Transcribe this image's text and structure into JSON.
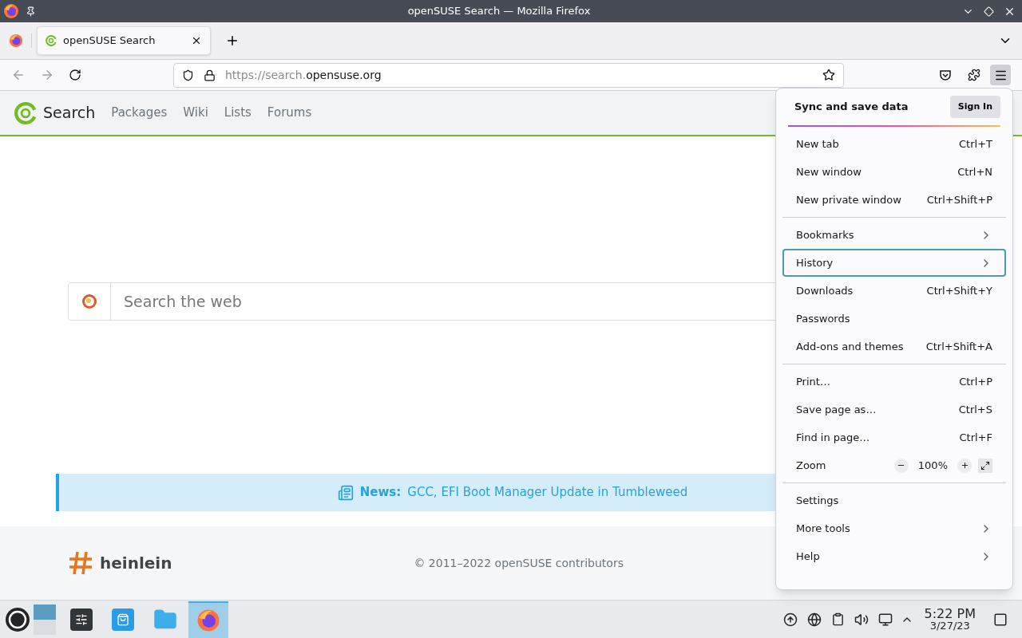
{
  "window": {
    "title": "openSUSE Search — Mozilla Firefox"
  },
  "tabs": [
    {
      "label": "openSUSE Search",
      "selected": true
    }
  ],
  "address_bar": {
    "url_prefix": "https://search.",
    "url_domain": "opensuse.org"
  },
  "site_header": {
    "brand": "Search",
    "nav": [
      "Packages",
      "Wiki",
      "Lists",
      "Forums"
    ]
  },
  "search": {
    "placeholder": "Search the web"
  },
  "news": {
    "label": "News:",
    "headline": "GCC, EFI Boot Manager Update in Tumbleweed"
  },
  "footer": {
    "sponsor": "heinlein",
    "copyright": "© 2011–2022 openSUSE contributors"
  },
  "app_menu": {
    "header": "Sync and save data",
    "sign_in": "Sign In",
    "groups": [
      [
        {
          "kind": "shortcut",
          "label": "New tab",
          "shortcut": "Ctrl+T",
          "selected": false
        },
        {
          "kind": "shortcut",
          "label": "New window",
          "shortcut": "Ctrl+N",
          "selected": false
        },
        {
          "kind": "shortcut",
          "label": "New private window",
          "shortcut": "Ctrl+Shift+P",
          "selected": false
        }
      ],
      [
        {
          "kind": "submenu",
          "label": "Bookmarks",
          "selected": false
        },
        {
          "kind": "submenu",
          "label": "History",
          "selected": true
        },
        {
          "kind": "shortcut",
          "label": "Downloads",
          "shortcut": "Ctrl+Shift+Y",
          "selected": false
        },
        {
          "kind": "shortcut",
          "label": "Passwords",
          "selected": false
        },
        {
          "kind": "shortcut",
          "label": "Add-ons and themes",
          "shortcut": "Ctrl+Shift+A",
          "selected": false
        }
      ],
      [
        {
          "kind": "shortcut",
          "label": "Print…",
          "shortcut": "Ctrl+P",
          "selected": false
        },
        {
          "kind": "shortcut",
          "label": "Save page as…",
          "shortcut": "Ctrl+S",
          "selected": false
        },
        {
          "kind": "shortcut",
          "label": "Find in page…",
          "shortcut": "Ctrl+F",
          "selected": false
        },
        {
          "kind": "zoom",
          "label": "Zoom",
          "value": "100%",
          "selected": false
        }
      ],
      [
        {
          "kind": "shortcut",
          "label": "Settings",
          "selected": false
        },
        {
          "kind": "submenu",
          "label": "More tools",
          "selected": false
        },
        {
          "kind": "submenu",
          "label": "Help",
          "selected": false
        }
      ]
    ]
  },
  "taskbar": {
    "time": "5:22 PM",
    "date": "3/27/23",
    "browser_active": true
  }
}
